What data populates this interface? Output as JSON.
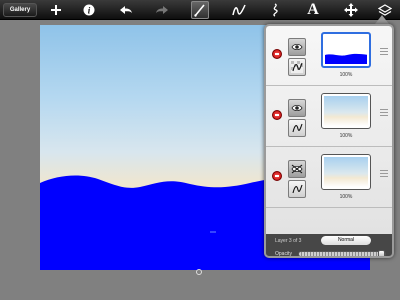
{
  "toolbar": {
    "gallery_label": "Gallery",
    "icons": [
      "add-icon",
      "info-icon",
      "undo-icon",
      "redo-icon",
      "brush-icon",
      "smudge-icon",
      "bristle-icon",
      "text-icon",
      "transform-icon",
      "layers-icon"
    ],
    "active_tool": "brush-icon",
    "text_tool_label": "A"
  },
  "canvas": {
    "sky_colors": [
      "#8fc3e9",
      "#f1e6cd",
      "#ffffff"
    ],
    "water_color": "#0000ff"
  },
  "layers_panel": {
    "layers": [
      {
        "opacity_label": "100%",
        "visible": true,
        "selected": true,
        "content": "blue water"
      },
      {
        "opacity_label": "100%",
        "visible": true,
        "selected": false,
        "content": "sky"
      },
      {
        "opacity_label": "100%",
        "visible": false,
        "selected": false,
        "content": "sky"
      }
    ],
    "layer_info": "Layer 3 of 3",
    "blend_mode": "Normal",
    "opacity_label": "Opacity",
    "opacity_value": 1.0,
    "bottom_icons": [
      "add-layer-icon",
      "merge-layer-icon",
      "layer-settings-icon",
      "layer-export-icon"
    ]
  }
}
